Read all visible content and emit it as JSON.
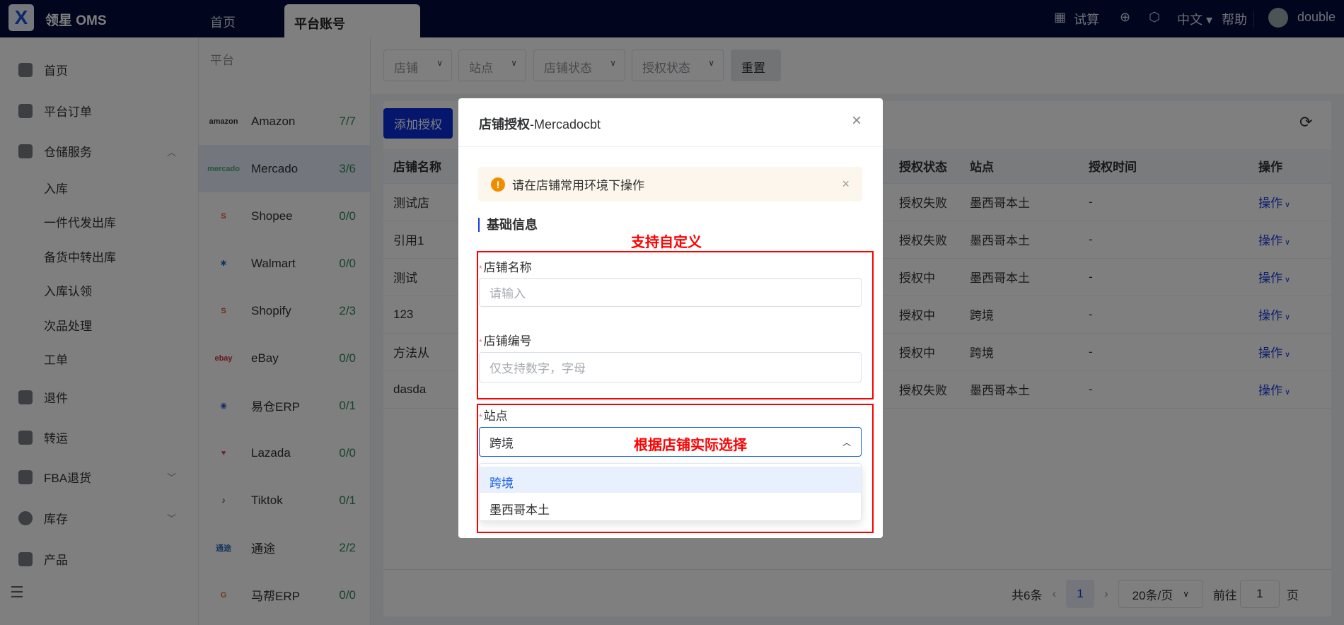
{
  "header": {
    "app_name": "领星 OMS",
    "tabs": [
      "首页",
      "平台账号"
    ],
    "calc": "试算",
    "lang": "中文",
    "help": "帮助",
    "user": "double"
  },
  "sidebar": {
    "items": [
      "首页",
      "平台订单",
      "仓储服务",
      "退件",
      "转运",
      "FBA退货",
      "库存",
      "产品"
    ],
    "sub_items": [
      "入库",
      "一件代发出库",
      "备货中转出库",
      "入库认领",
      "次品处理",
      "工单"
    ]
  },
  "platforms": {
    "title": "平台",
    "items": [
      {
        "name": "Amazon",
        "count": "7/7",
        "logo": "amazon"
      },
      {
        "name": "Mercado",
        "count": "3/6",
        "logo": "mercado"
      },
      {
        "name": "Shopee",
        "count": "0/0",
        "logo": "S"
      },
      {
        "name": "Walmart",
        "count": "0/0",
        "logo": "✱"
      },
      {
        "name": "Shopify",
        "count": "2/3",
        "logo": "S"
      },
      {
        "name": "eBay",
        "count": "0/0",
        "logo": "ebay"
      },
      {
        "name": "易仓ERP",
        "count": "0/1",
        "logo": "◉"
      },
      {
        "name": "Lazada",
        "count": "0/0",
        "logo": "♥"
      },
      {
        "name": "Tiktok",
        "count": "0/1",
        "logo": "♪"
      },
      {
        "name": "通途",
        "count": "2/2",
        "logo": "通途"
      },
      {
        "name": "马帮ERP",
        "count": "0/0",
        "logo": "G"
      }
    ]
  },
  "filters": {
    "shop": "店铺",
    "site": "站点",
    "shop_status": "店铺状态",
    "auth_status": "授权状态",
    "reset": "重置"
  },
  "main": {
    "add_button": "添加授权"
  },
  "table": {
    "headers": [
      "店铺名称",
      "授权状态",
      "站点",
      "授权时间",
      "操作"
    ],
    "rows": [
      [
        "测试店",
        "授权失败",
        "墨西哥本土",
        "-",
        "操作"
      ],
      [
        "引用1",
        "授权失败",
        "墨西哥本土",
        "-",
        "操作"
      ],
      [
        "测试",
        "授权中",
        "墨西哥本土",
        "-",
        "操作"
      ],
      [
        "123",
        "授权中",
        "跨境",
        "-",
        "操作"
      ],
      [
        "方法从",
        "授权中",
        "跨境",
        "-",
        "操作"
      ],
      [
        "dasda",
        "授权失败",
        "墨西哥本土",
        "-",
        "操作"
      ]
    ]
  },
  "pagination": {
    "total": "共6条",
    "page": "1",
    "page_size": "20条/页",
    "goto": "前往",
    "goto_value": "1",
    "page_suffix": "页"
  },
  "modal": {
    "title_bold": "店铺授权",
    "title_rest": "-Mercadocbt",
    "alert": "请在店铺常用环境下操作",
    "section": "基础信息",
    "annotation1": "支持自定义",
    "annotation2": "根据店铺实际选择",
    "shop_name_label": "店铺名称",
    "shop_name_placeholder": "请输入",
    "shop_code_label": "店铺编号",
    "shop_code_placeholder": "仅支持数字，字母",
    "site_label": "站点",
    "site_value": "跨境",
    "site_options": [
      "跨境",
      "墨西哥本土"
    ]
  }
}
